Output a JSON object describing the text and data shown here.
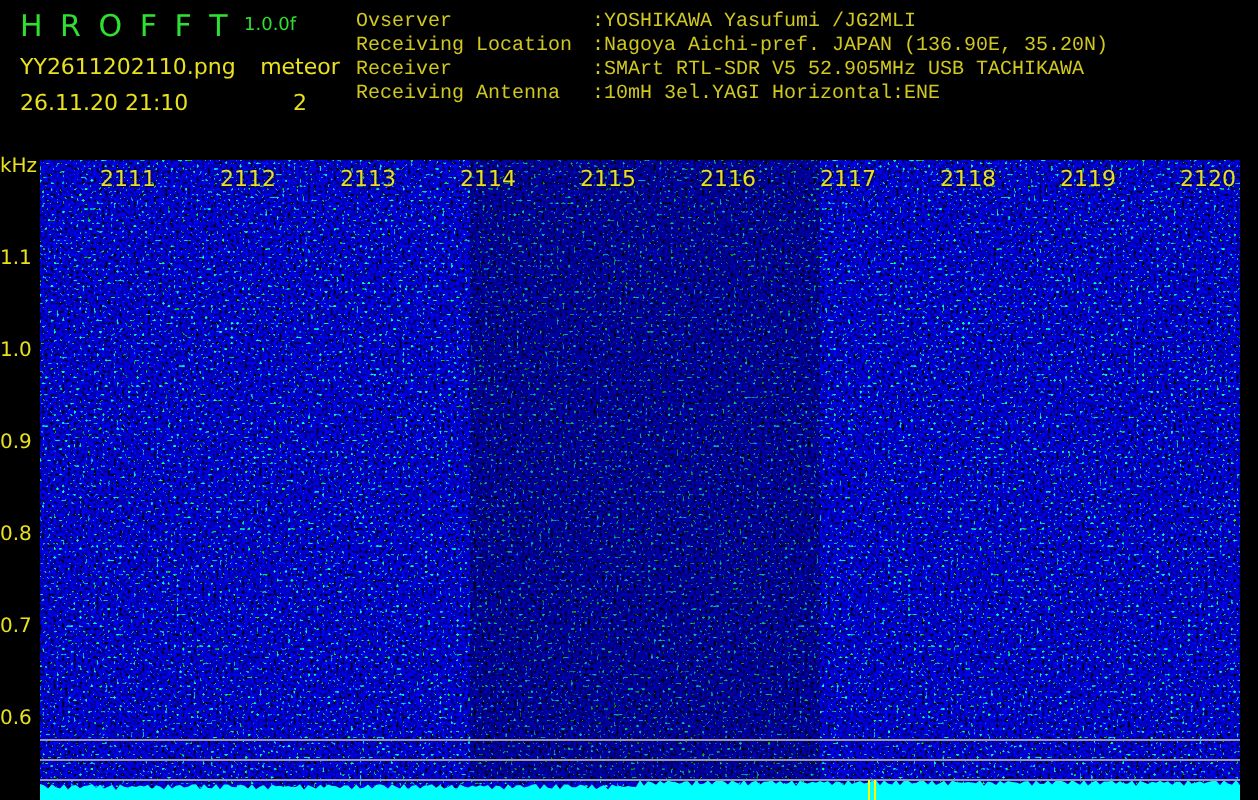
{
  "header": {
    "app_name": "H R O F F T",
    "version": "1.0.0f",
    "file_name": "YY2611202110.png",
    "date_time": "26.11.20 21:10",
    "detection_label": "meteor",
    "detection_count": "2"
  },
  "info": [
    {
      "label": "Ovserver",
      "value": ":YOSHIKAWA Yasufumi /JG2MLI"
    },
    {
      "label": "Receiving Location",
      "value": ":Nagoya Aichi-pref. JAPAN (136.90E, 35.20N)"
    },
    {
      "label": "Receiver",
      "value": ":SMArt RTL-SDR V5 52.905MHz USB TACHIKAWA"
    },
    {
      "label": "Receiving Antenna",
      "value": ":10mH 3el.YAGI Horizontal:ENE"
    }
  ],
  "spectrogram": {
    "y_unit": "kHz",
    "y_ticks": [
      "1.1",
      "1.0",
      "0.9",
      "0.8",
      "0.7",
      "0.6"
    ],
    "x_ticks": [
      "2111",
      "2112",
      "2113",
      "2114",
      "2115",
      "2116",
      "2117",
      "2118",
      "2119",
      "2120"
    ]
  }
}
